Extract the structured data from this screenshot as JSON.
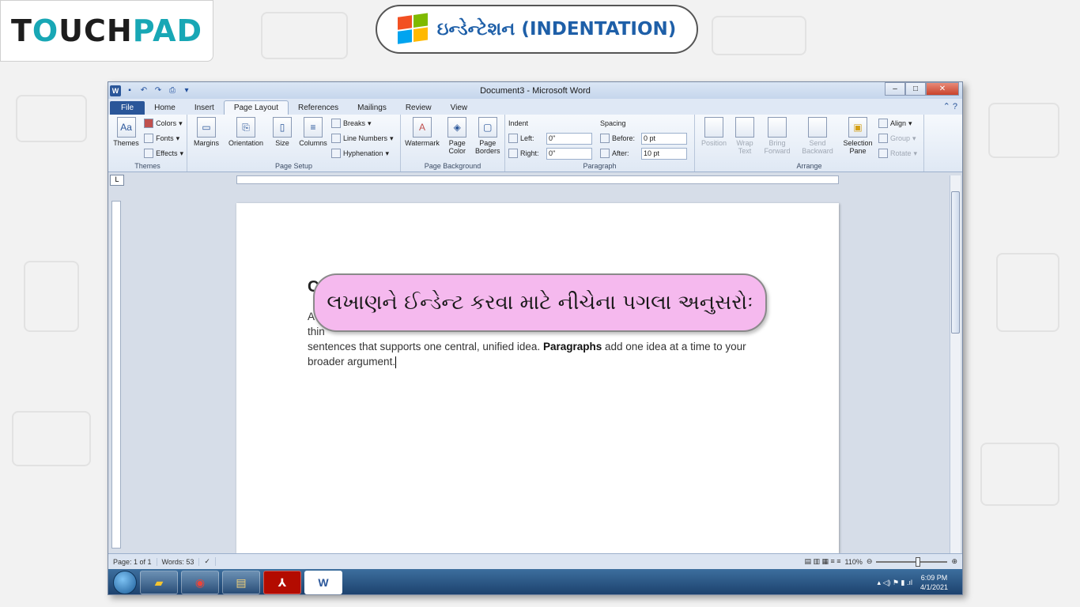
{
  "branding": {
    "logo_left": "T",
    "logo_o": "O",
    "logo_mid": "UCH",
    "logo_pad": "PAD",
    "title": "ઇન્ડેન્ટેશન (INDENTATION)"
  },
  "window": {
    "title": "Document3 - Microsoft Word",
    "minimize": "–",
    "maximize": "□",
    "close": "✕"
  },
  "tabs": [
    "File",
    "Home",
    "Insert",
    "Page Layout",
    "References",
    "Mailings",
    "Review",
    "View"
  ],
  "active_tab": "Page Layout",
  "ribbon": {
    "themes": {
      "themes_label": "Themes",
      "colors": "Colors",
      "fonts": "Fonts",
      "effects": "Effects",
      "group": "Themes"
    },
    "page_setup": {
      "margins": "Margins",
      "orientation": "Orientation",
      "size": "Size",
      "columns": "Columns",
      "breaks": "Breaks",
      "line_numbers": "Line Numbers",
      "hyphenation": "Hyphenation",
      "group": "Page Setup"
    },
    "page_background": {
      "watermark": "Watermark",
      "page_color": "Page Color",
      "page_borders": "Page Borders",
      "group": "Page Background"
    },
    "paragraph": {
      "indent": "Indent",
      "left": "Left:",
      "left_val": "0\"",
      "right": "Right:",
      "right_val": "0\"",
      "spacing": "Spacing",
      "before": "Before:",
      "before_val": "0 pt",
      "after": "After:",
      "after_val": "10 pt",
      "group": "Paragraph"
    },
    "arrange": {
      "position": "Position",
      "wrap_text": "Wrap Text",
      "bring_forward": "Bring Forward",
      "send_backward": "Send Backward",
      "selection_pane": "Selection Pane",
      "align": "Align",
      "group_btn": "Group",
      "rotate": "Rotate",
      "group": "Arrange"
    }
  },
  "document": {
    "heading": "C",
    "line1": "A",
    "line2_start": "thin",
    "line3_a": "sentences that supports one central, unified idea. ",
    "line3_bold": "Paragraphs",
    "line3_b": " add one idea at a time to your",
    "line4": "broader argument."
  },
  "callout": {
    "text": "લખાણને ઈન્ડેન્ટ કરવા માટે નીચેના પગલા અનુસરોઃ"
  },
  "status": {
    "page": "Page: 1 of 1",
    "words": "Words: 53",
    "zoom": "110%"
  },
  "taskbar": {
    "time": "6:09 PM",
    "date": "4/1/2021"
  }
}
